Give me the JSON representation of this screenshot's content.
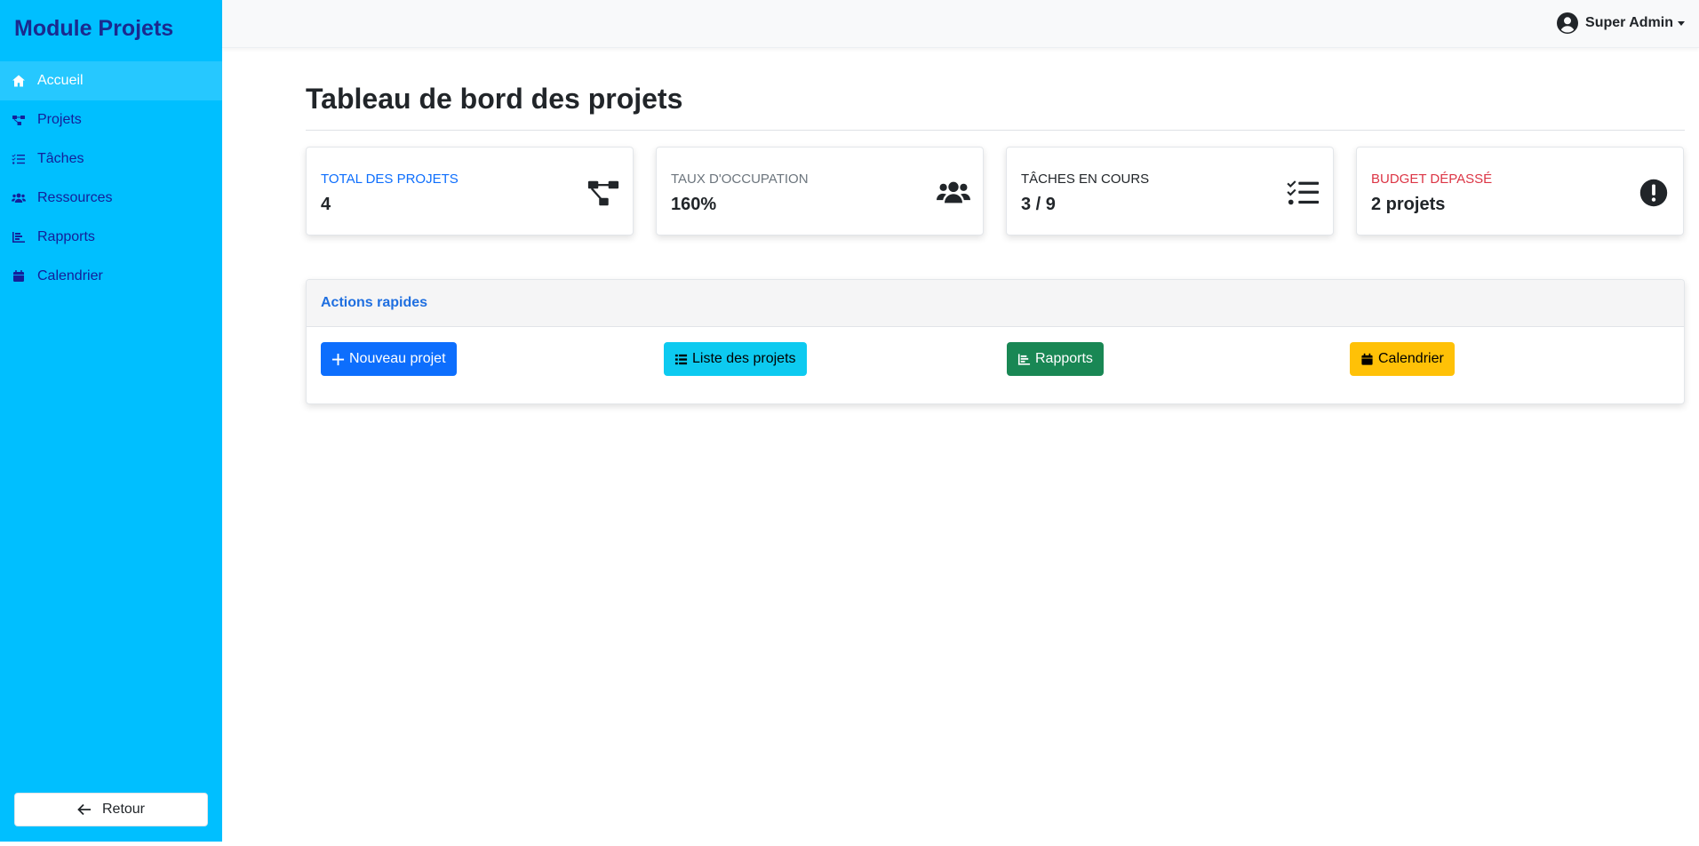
{
  "sidebar": {
    "brand": "Module Projets",
    "items": [
      {
        "label": "Accueil",
        "icon": "home-icon",
        "active": true
      },
      {
        "label": "Projets",
        "icon": "project-diagram-icon"
      },
      {
        "label": "Tâches",
        "icon": "tasks-icon"
      },
      {
        "label": "Ressources",
        "icon": "users-icon"
      },
      {
        "label": "Rapports",
        "icon": "chart-bar-icon"
      },
      {
        "label": "Calendrier",
        "icon": "calendar-icon"
      }
    ],
    "back_label": "Retour"
  },
  "header": {
    "user_name": "Super Admin"
  },
  "main": {
    "title": "Tableau de bord des projets",
    "cards": [
      {
        "label": "TOTAL DES PROJETS",
        "value": "4",
        "icon": "project-diagram-icon",
        "label_color": "#0d6efd"
      },
      {
        "label": "TAUX D'OCCUPATION",
        "value": "160%",
        "icon": "users-icon",
        "label_color": "#6c757d"
      },
      {
        "label": "TÂCHES EN COURS",
        "value": "3 / 9",
        "icon": "tasks-icon",
        "label_color": "#212529"
      },
      {
        "label": "BUDGET DÉPASSÉ",
        "value": "2 projets",
        "icon": "exclamation-circle-icon",
        "label_color": "#dc3545"
      }
    ],
    "quick_actions": {
      "title": "Actions rapides",
      "buttons": [
        {
          "label": "Nouveau projet",
          "icon": "plus-icon",
          "color": "#0d6efd"
        },
        {
          "label": "Liste des projets",
          "icon": "list-icon",
          "color": "#0dcaf0"
        },
        {
          "label": "Rapports",
          "icon": "chart-bar-icon",
          "color": "#198754"
        },
        {
          "label": "Calendrier",
          "icon": "calendar-icon",
          "color": "#ffc107"
        }
      ]
    }
  }
}
